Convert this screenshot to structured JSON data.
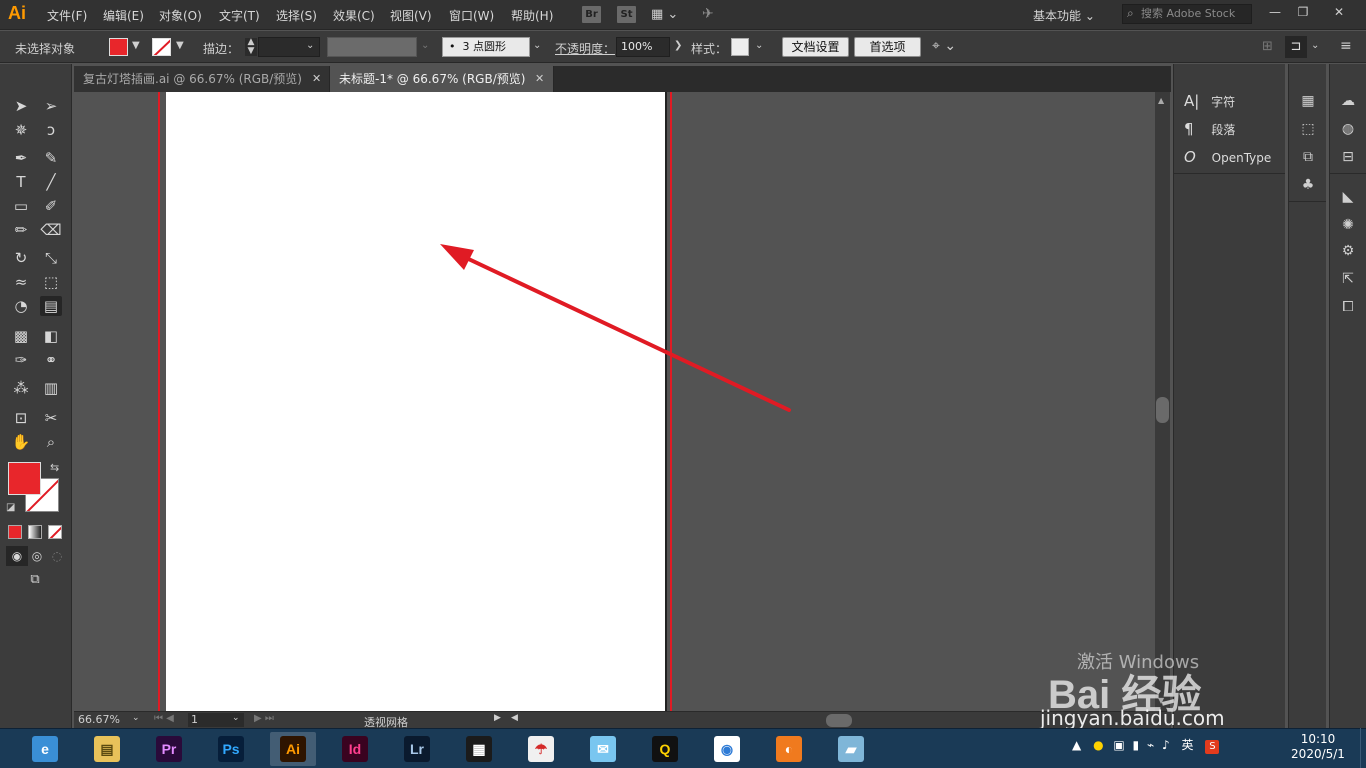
{
  "app": {
    "logo": "Ai"
  },
  "menu": [
    "文件(F)",
    "编辑(E)",
    "对象(O)",
    "文字(T)",
    "选择(S)",
    "效果(C)",
    "视图(V)",
    "窗口(W)",
    "帮助(H)"
  ],
  "bridge_buttons": [
    "Br",
    "St"
  ],
  "workspace": "基本功能",
  "search": {
    "placeholder": "搜索 Adobe Stock"
  },
  "control_bar": {
    "selection": "未选择对象",
    "stroke_label": "描边：",
    "brush": "3 点圆形",
    "opacity_label": "不透明度：",
    "opacity_value": "100%",
    "style_label": "样式：",
    "doc_setup": "文档设置",
    "preferences": "首选项"
  },
  "tabs": [
    {
      "label": "复古灯塔插画.ai @ 66.67% (RGB/预览)",
      "active": false
    },
    {
      "label": "未标题-1* @ 66.67% (RGB/预览)",
      "active": true
    }
  ],
  "tools": {
    "fill_color": "#e8262b",
    "stroke_color": "#ffffff"
  },
  "typo_panel": [
    {
      "icon": "character-icon",
      "glyph": "A|",
      "label": "字符"
    },
    {
      "icon": "paragraph-icon",
      "glyph": "¶",
      "label": "段落"
    },
    {
      "icon": "opentype-icon",
      "glyph": "O",
      "label": "OpenType"
    }
  ],
  "status": {
    "zoom": "66.67%",
    "artboard": "1",
    "tool_name": "透视网格"
  },
  "taskbar": {
    "apps": [
      {
        "name": "browser-360",
        "label": "e",
        "bg": "#3a8fd6",
        "fg": "#ffffff",
        "running": false
      },
      {
        "name": "file-explorer",
        "label": "▤",
        "bg": "#e8c25a",
        "fg": "#5a4a10",
        "running": false
      },
      {
        "name": "premiere",
        "label": "Pr",
        "bg": "#2a0a3a",
        "fg": "#e38cff",
        "running": false
      },
      {
        "name": "photoshop",
        "label": "Ps",
        "bg": "#061e3a",
        "fg": "#31a8ff",
        "running": false
      },
      {
        "name": "illustrator",
        "label": "Ai",
        "bg": "#2e1400",
        "fg": "#ff9a00",
        "running": true
      },
      {
        "name": "indesign",
        "label": "Id",
        "bg": "#3a0320",
        "fg": "#ff3f8e",
        "running": false
      },
      {
        "name": "lightroom",
        "label": "Lr",
        "bg": "#0a1a2e",
        "fg": "#a7c7e8",
        "running": false
      },
      {
        "name": "video-editor",
        "label": "▦",
        "bg": "#1b1b1b",
        "fg": "#ffffff",
        "running": false
      },
      {
        "name": "umbrella-app",
        "label": "☂",
        "bg": "#f0f0f0",
        "fg": "#d42a2a",
        "running": false
      },
      {
        "name": "chat-bird-app",
        "label": "✉",
        "bg": "#79c6f0",
        "fg": "#ffffff",
        "running": false
      },
      {
        "name": "qq",
        "label": "Q",
        "bg": "#111111",
        "fg": "#ffd200",
        "running": false
      },
      {
        "name": "chrome",
        "label": "◉",
        "bg": "#ffffff",
        "fg": "#2e7bd6",
        "running": false
      },
      {
        "name": "fox-app",
        "label": "◐",
        "bg": "#f07a1e",
        "fg": "#ffffff",
        "running": false
      },
      {
        "name": "notes-app",
        "label": "▰",
        "bg": "#7fb6d8",
        "fg": "#ffffff",
        "running": false
      }
    ],
    "ime": "英",
    "time": "10:10",
    "date": "2020/5/1"
  },
  "watermark": {
    "activate": "激活 Windows",
    "brand": "Bai 经验",
    "url": "jingyan.baidu.com"
  },
  "colors": {
    "annotation_arrow": "#e01b24",
    "bleed_line": "#e01b24"
  }
}
